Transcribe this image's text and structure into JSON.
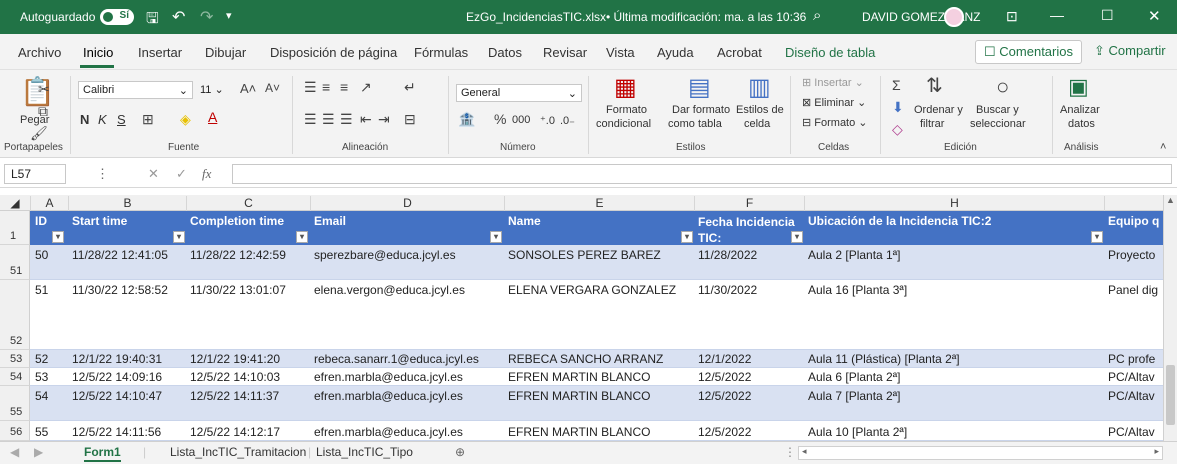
{
  "titlebar": {
    "autosave": "Autoguardado",
    "autosave_state": "Sí",
    "filename": "EzGo_IncidenciasTIC.xlsx",
    "modified": "• Última modificación: ma. a las 10:36",
    "user": "DAVID GOMEZ SANZ"
  },
  "menu": {
    "items": [
      "Archivo",
      "Inicio",
      "Insertar",
      "Dibujar",
      "Disposición de página",
      "Fórmulas",
      "Datos",
      "Revisar",
      "Vista",
      "Ayuda",
      "Acrobat",
      "Diseño de tabla"
    ],
    "comments": "Comentarios",
    "share": "Compartir"
  },
  "ribbon": {
    "paste": "Pegar",
    "font_name": "Calibri",
    "font_size": "11",
    "bold": "N",
    "italic": "K",
    "underline": "S",
    "number_format": "General",
    "cond_format": "Formato",
    "cond_format2": "condicional",
    "format_table": "Dar formato",
    "format_table2": "como tabla",
    "cell_styles": "Estilos de",
    "cell_styles2": "celda",
    "insert": "Insertar",
    "delete": "Eliminar",
    "format": "Formato",
    "sort": "Ordenar y",
    "sort2": "filtrar",
    "find": "Buscar y",
    "find2": "seleccionar",
    "analyze": "Analizar",
    "analyze2": "datos",
    "groups": [
      "Portapapeles",
      "Fuente",
      "Alineación",
      "Número",
      "Estilos",
      "Celdas",
      "Edición",
      "Análisis"
    ]
  },
  "formula": {
    "namebox": "L57",
    "fx": "fx",
    "value": ""
  },
  "columns": [
    "A",
    "B",
    "C",
    "D",
    "E",
    "F",
    "H"
  ],
  "headers": [
    "ID",
    "Start time",
    "Completion time",
    "Email",
    "Name",
    "Fecha Incidencia TIC:",
    "Ubicación de la Incidencia TIC:2",
    "Equipo q"
  ],
  "header_row_num": "1",
  "rows": [
    {
      "num": "51",
      "cells": [
        "50",
        "11/28/22 12:41:05",
        "11/28/22 12:42:59",
        "sperezbare@educa.jcyl.es",
        "SONSOLES PEREZ BAREZ",
        "11/28/2022",
        "Aula 2 [Planta 1ª]",
        "Proyecto"
      ]
    },
    {
      "num": "52",
      "cells": [
        "51",
        "11/30/22 12:58:52",
        "11/30/22 13:01:07",
        "elena.vergon@educa.jcyl.es",
        "ELENA VERGARA GONZALEZ",
        "11/30/2022",
        "Aula 16 [Planta 3ª]",
        "Panel dig"
      ]
    },
    {
      "num": "53",
      "cells": [
        "52",
        "12/1/22 19:40:31",
        "12/1/22 19:41:20",
        "rebeca.sanarr.1@educa.jcyl.es",
        "REBECA SANCHO ARRANZ",
        "12/1/2022",
        "Aula 11 (Plástica) [Planta 2ª]",
        "PC profe"
      ]
    },
    {
      "num": "54",
      "cells": [
        "53",
        "12/5/22 14:09:16",
        "12/5/22 14:10:03",
        "efren.marbla@educa.jcyl.es",
        "EFREN MARTIN BLANCO",
        "12/5/2022",
        "Aula 6 [Planta 2ª]",
        "PC/Altav"
      ]
    },
    {
      "num": "55",
      "cells": [
        "54",
        "12/5/22 14:10:47",
        "12/5/22 14:11:37",
        "efren.marbla@educa.jcyl.es",
        "EFREN MARTIN BLANCO",
        "12/5/2022",
        "Aula 7 [Planta 2ª]",
        "PC/Altav"
      ]
    },
    {
      "num": "56",
      "cells": [
        "55",
        "12/5/22 14:11:56",
        "12/5/22 14:12:17",
        "efren.marbla@educa.jcyl.es",
        "EFREN MARTIN BLANCO",
        "12/5/2022",
        "Aula 10 [Planta 2ª]",
        "PC/Altav"
      ]
    }
  ],
  "sheets": [
    "Form1",
    "Lista_IncTIC_Tramitacion",
    "Lista_IncTIC_Tipo"
  ],
  "colors": {
    "excel_green": "#217346",
    "table_header": "#4472c4",
    "band": "#d9e1f2"
  }
}
